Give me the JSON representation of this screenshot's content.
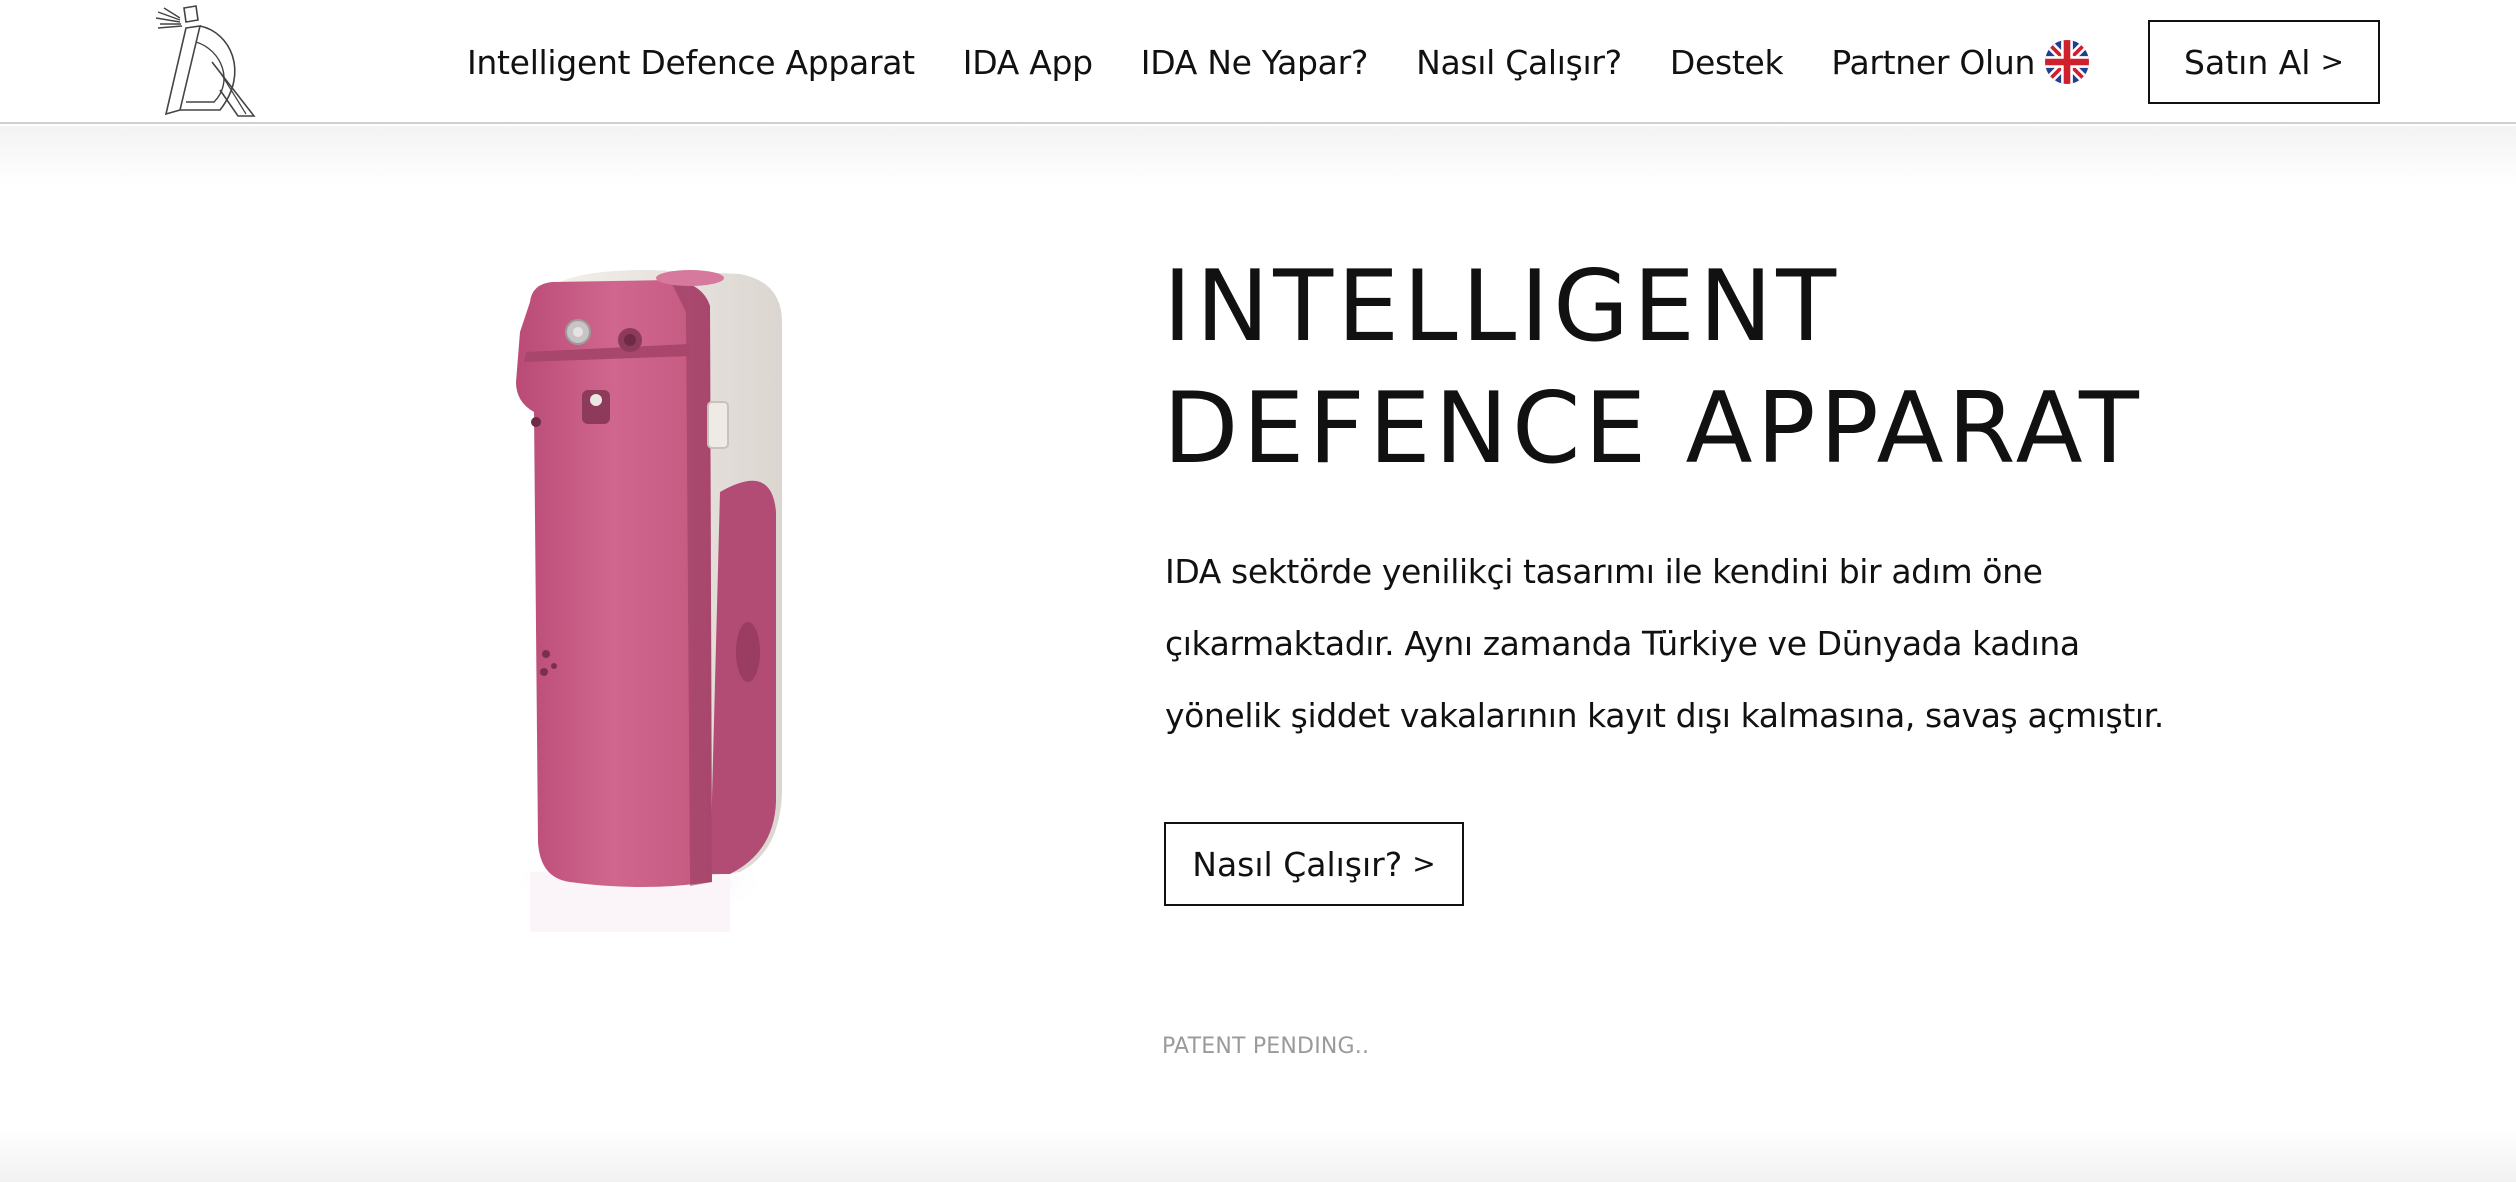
{
  "header": {
    "logo_icon": "ida-logo-icon",
    "nav": [
      {
        "label": "Intelligent Defence Apparat"
      },
      {
        "label": "IDA App"
      },
      {
        "label": "IDA Ne Yapar?"
      },
      {
        "label": "Nasıl Çalışır?"
      },
      {
        "label": "Destek"
      },
      {
        "label": "Partner Olun"
      }
    ],
    "language_icon": "uk-flag-icon",
    "buy_label": "Satın Al",
    "chevron": ">"
  },
  "hero": {
    "title_line1": "INTELLIGENT",
    "title_line2": "DEFENCE APPARAT",
    "description": "IDA sektörde yenilikçi tasarımı ile kendini bir adım öne çıkarmaktadır. Aynı zamanda Türkiye ve Dünyada kadına yönelik şiddet vakalarının kayıt dışı kalmasına, savaş açmıştır.",
    "cta_label": "Nasıl Çalışır?",
    "cta_chevron": ">",
    "patent": "PATENT PENDING.."
  },
  "colors": {
    "product_pink": "#c95f86",
    "product_dark_pink": "#8f3a5c",
    "product_white": "#ebe6e2",
    "text": "#111111",
    "muted": "#9a9a9a"
  }
}
